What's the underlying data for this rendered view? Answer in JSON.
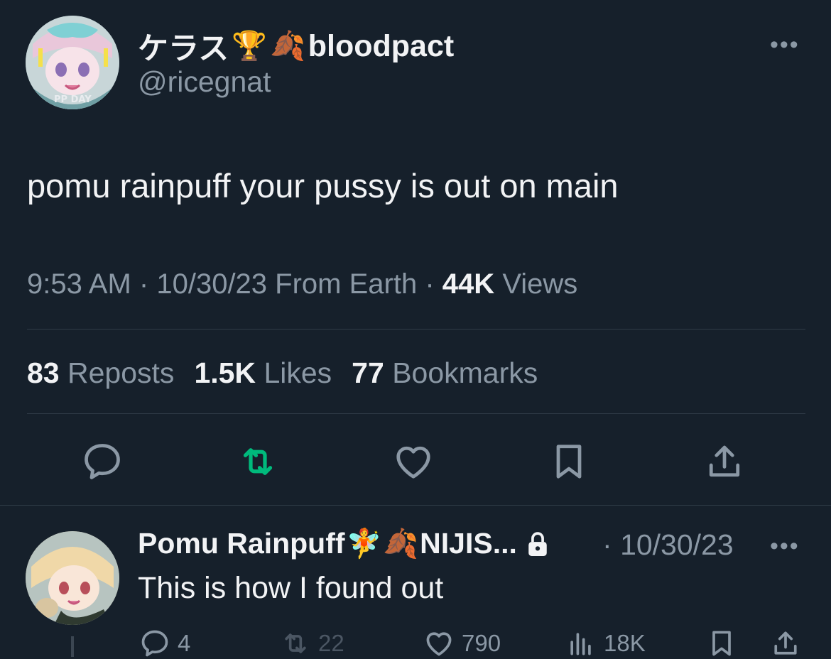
{
  "tweet": {
    "author": {
      "name_prefix": "ケラス",
      "emoji_1": "🏆",
      "emoji_2": "🍂",
      "name_suffix": "bloodpact",
      "handle": "@ricegnat",
      "avatar_icon": "anime-avatar"
    },
    "more_label": "•••",
    "text": "pomu rainpuff your pussy is out on main",
    "time": "9:53 AM",
    "date": "10/30/23",
    "source": "From Earth",
    "views_count": "44K",
    "views_label": "Views",
    "separator": "·",
    "stats": {
      "reposts_count": "83",
      "reposts_label": "Reposts",
      "likes_count": "1.5K",
      "likes_label": "Likes",
      "bookmarks_count": "77",
      "bookmarks_label": "Bookmarks"
    },
    "actions": [
      "reply-icon",
      "repost-icon",
      "like-icon",
      "bookmark-icon",
      "share-icon"
    ],
    "colors": {
      "background": "#16202b",
      "muted_text": "#8b98a5",
      "repost_active": "#00ba7c"
    }
  },
  "reply": {
    "author": {
      "name": "Pomu Rainpuff",
      "emoji_1": "🧚",
      "emoji_2": "🍂",
      "name_truncated": "NIJIS...",
      "lock_icon": "lock-icon",
      "avatar_icon": "anime-avatar"
    },
    "separator": "·",
    "date": "10/30/23",
    "more_label": "•••",
    "text": "This is how I found out",
    "actions": {
      "replies": "4",
      "reposts": "22",
      "likes": "790",
      "views": "18K"
    }
  }
}
